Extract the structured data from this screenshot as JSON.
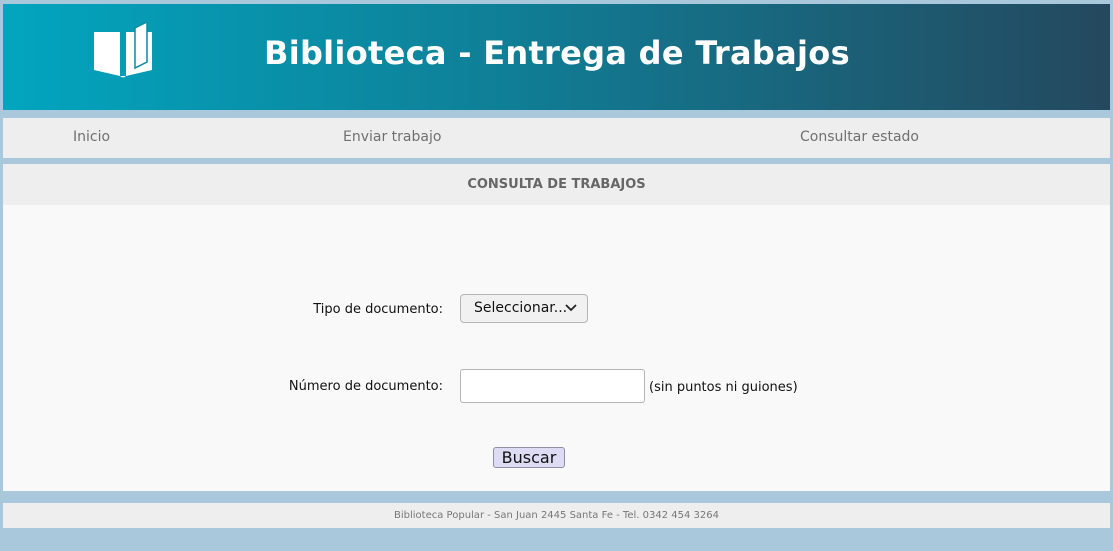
{
  "header": {
    "title": "Biblioteca - Entrega de Trabajos",
    "logo_icon": "open-book-icon"
  },
  "nav": {
    "items": [
      {
        "label": "Inicio"
      },
      {
        "label": "Enviar trabajo"
      },
      {
        "label": "Consultar estado"
      }
    ]
  },
  "panel": {
    "heading": "CONSULTA DE TRABAJOS",
    "form": {
      "doc_type_label": "Tipo de documento:",
      "doc_type_selected": "Seleccionar...",
      "doc_number_label": "Número de documento:",
      "doc_number_value": "",
      "doc_number_hint": "(sin puntos ni guiones)",
      "search_button": "Buscar"
    }
  },
  "footer": {
    "text": "Biblioteca Popular - San Juan 2445 Santa Fe - Tel. 0342 454 3264"
  }
}
